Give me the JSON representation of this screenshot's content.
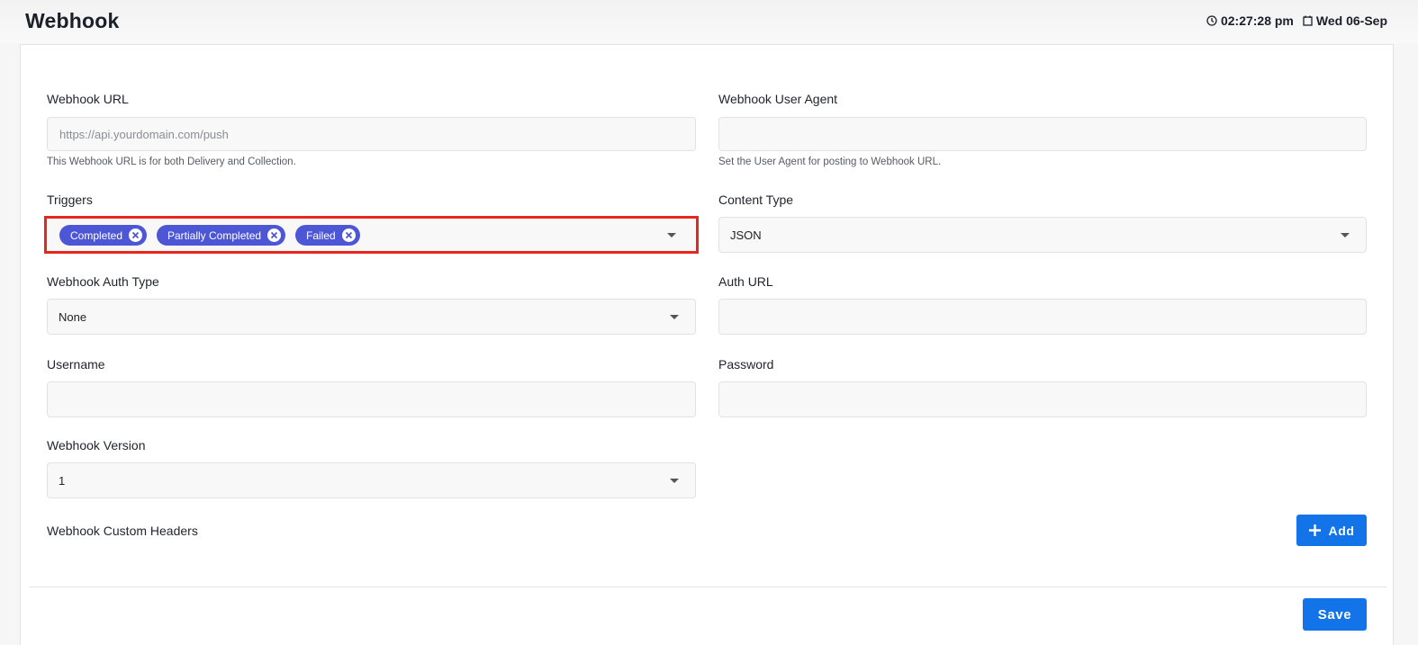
{
  "header": {
    "title": "Webhook",
    "time": "02:27:28 pm",
    "date": "Wed 06-Sep"
  },
  "form": {
    "webhook_url": {
      "label": "Webhook URL",
      "placeholder": "https://api.yourdomain.com/push",
      "help": "This Webhook URL is for both Delivery and Collection."
    },
    "user_agent": {
      "label": "Webhook User Agent",
      "value": "",
      "help": "Set the User Agent for posting to Webhook URL."
    },
    "triggers": {
      "label": "Triggers",
      "selected": [
        "Completed",
        "Partially Completed",
        "Failed"
      ]
    },
    "content_type": {
      "label": "Content Type",
      "value": "JSON"
    },
    "auth_type": {
      "label": "Webhook Auth Type",
      "value": "None"
    },
    "auth_url": {
      "label": "Auth URL",
      "value": ""
    },
    "username": {
      "label": "Username",
      "value": ""
    },
    "password": {
      "label": "Password",
      "value": ""
    },
    "version": {
      "label": "Webhook Version",
      "value": "1"
    },
    "custom_headers": {
      "label": "Webhook Custom Headers",
      "add_label": "Add"
    }
  },
  "footer": {
    "save_label": "Save"
  },
  "colors": {
    "accent": "#1373e8",
    "chip": "#4d57d6",
    "highlight": "#e8261c"
  }
}
